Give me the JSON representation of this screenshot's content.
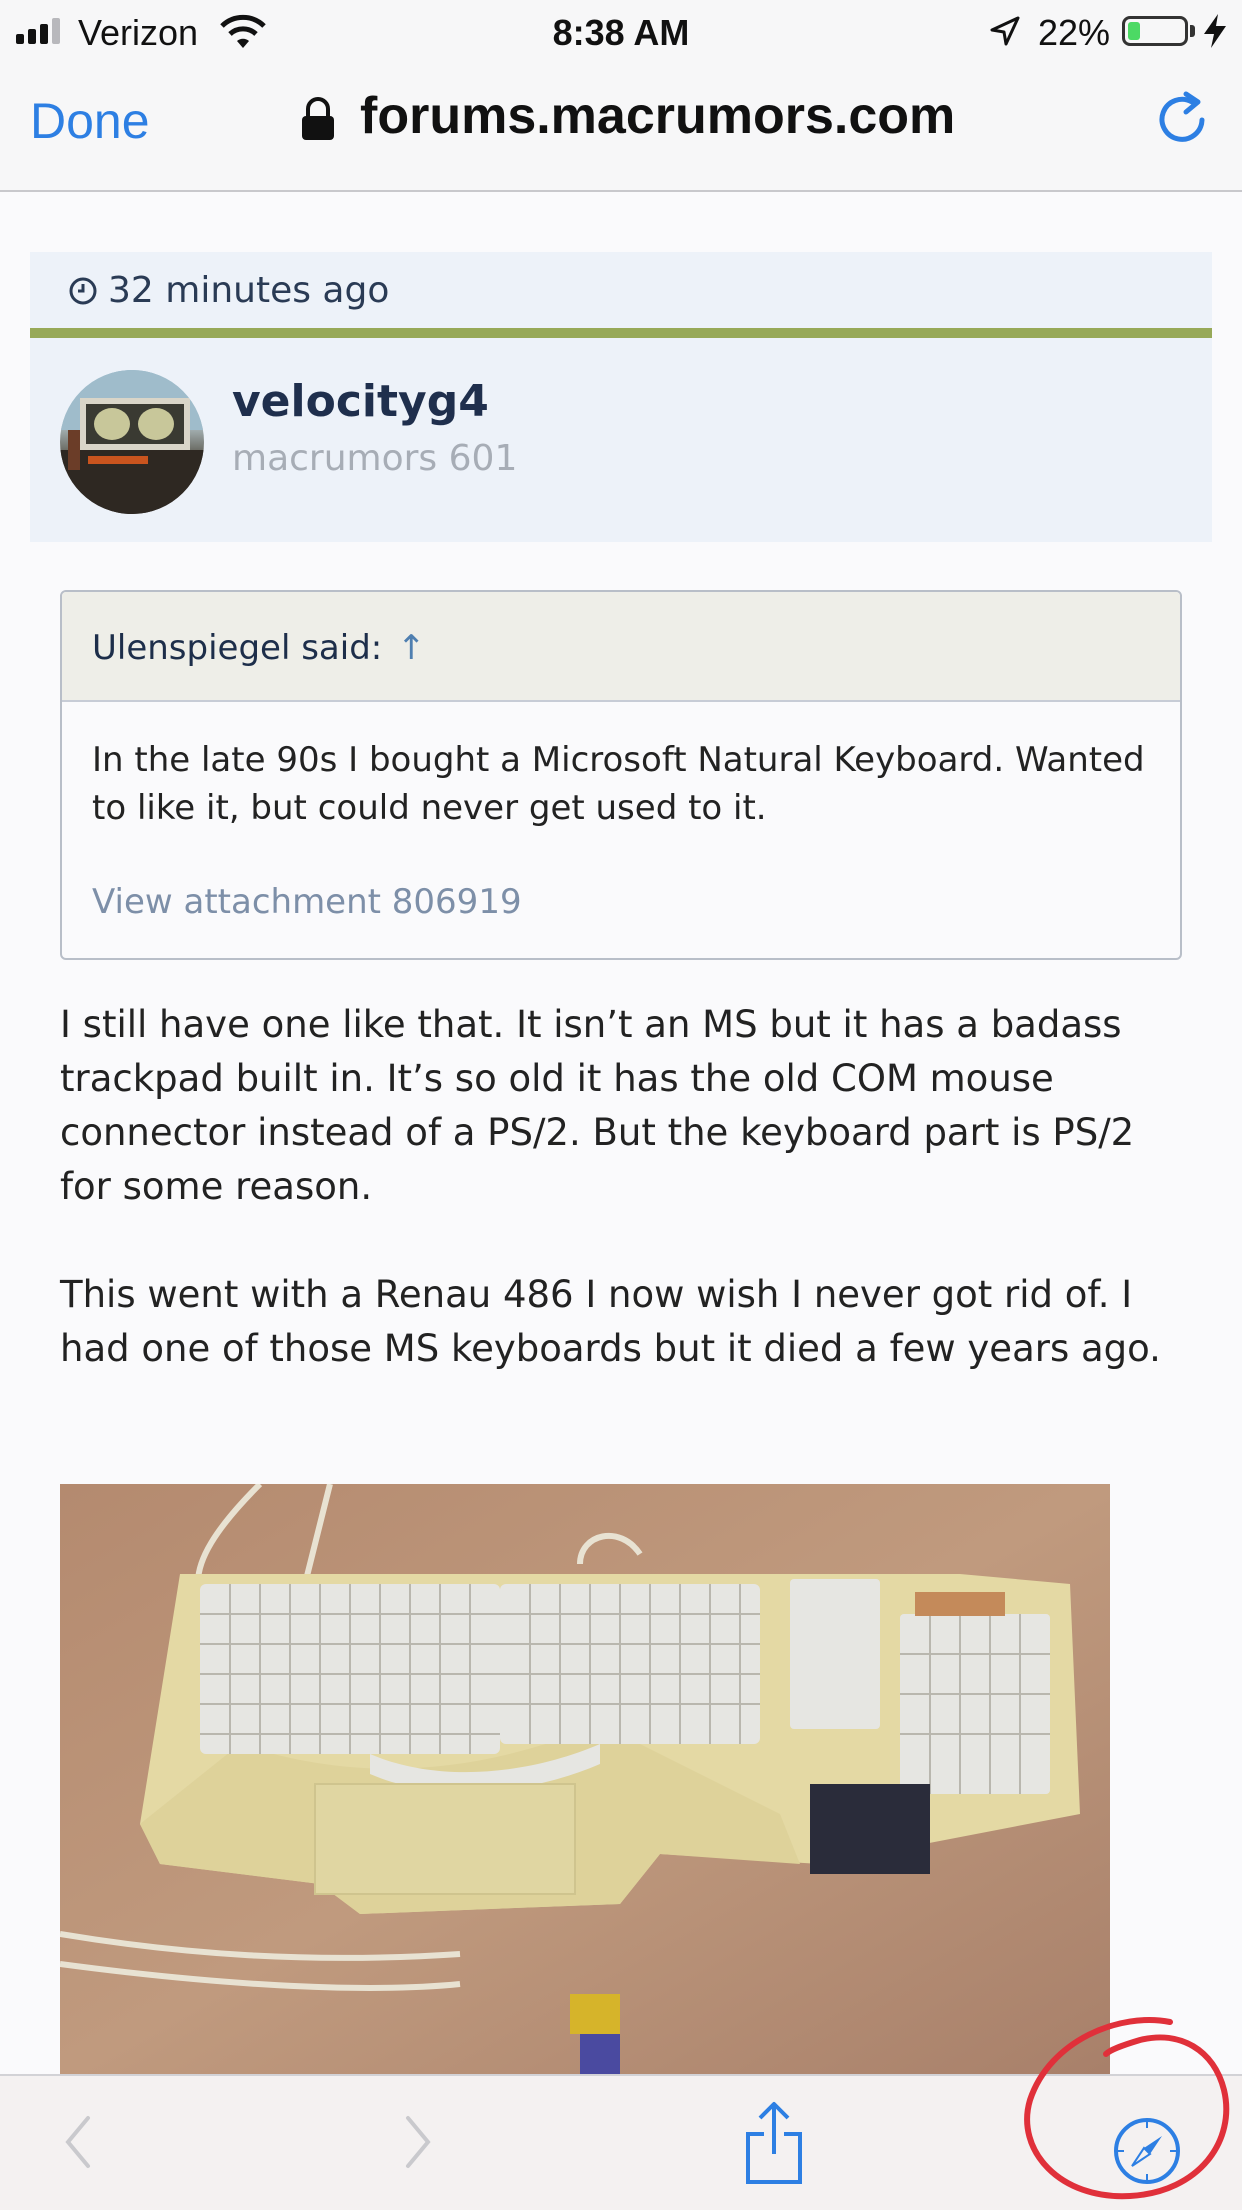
{
  "status_bar": {
    "carrier": "Verizon",
    "time": "8:38 AM",
    "battery_percent": "22%",
    "battery_level": 0.22
  },
  "nav": {
    "done_label": "Done",
    "url": "forums.macrumors.com"
  },
  "post": {
    "time": "32 minutes ago",
    "username": "velocityg4",
    "user_title": "macrumors 601",
    "quote": {
      "author": "Ulenspiegel said:",
      "jump_glyph": "↑",
      "text": "In the late 90s I bought a Microsoft Natural Keyboard. Wanted to like it, but could never get used to it.",
      "attachment": "View attachment 806919"
    },
    "paragraphs": [
      "I still have one like that. It isn’t an MS but it has a badass trackpad built in. It’s so old it has the old COM mouse connector instead of a PS/2. But the keyboard part is PS/2 for some reason.",
      "This went with a Renau 486 I now wish I never got rid of. I had one of those MS keyboards but it died a few years ago."
    ]
  },
  "colors": {
    "accent_blue": "#2d7fe3",
    "header_bg": "#edf2f9",
    "green_rule": "#97a958",
    "username": "#1f2f4d",
    "annotation_red": "#e0303a"
  }
}
